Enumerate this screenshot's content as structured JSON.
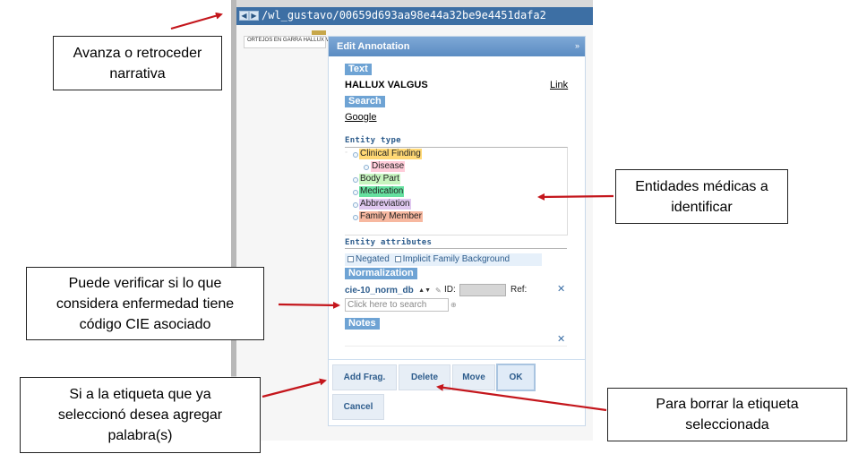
{
  "app": {
    "doc_path": "/wl_gustavo/00659d693aa98e44a32be9e4451dafa2",
    "nav_back_icon": "◀",
    "nav_forward_icon": "▶",
    "text_line": "ORTEJOS EN GARRA HALLUX VALGUS"
  },
  "dialog": {
    "title": "Edit Annotation",
    "close_icon": "»",
    "text_section": "Text",
    "text_value": "HALLUX VALGUS",
    "link_label": "Link",
    "search_section": "Search",
    "search_link": "Google",
    "entity_type_heading": "Entity type",
    "entity_types": [
      {
        "label": "Clinical Finding",
        "color": "#ffd875"
      },
      {
        "label": "Disease",
        "color": "#ffccd9"
      },
      {
        "label": "Body Part",
        "color": "#c8f5c0"
      },
      {
        "label": "Medication",
        "color": "#66e0a0"
      },
      {
        "label": "Abbreviation",
        "color": "#e0c8f0"
      },
      {
        "label": "Family Member",
        "color": "#f7b8a0"
      }
    ],
    "entity_attributes_heading": "Entity attributes",
    "attributes": [
      "Negated",
      "Implicit Family Background"
    ],
    "normalization_section": "Normalization",
    "norm_db": "cie-10_norm_db",
    "id_label": "ID:",
    "ref_label": "Ref:",
    "search_placeholder": "Click here to search",
    "notes_section": "Notes",
    "buttons": {
      "add_frag": "Add Frag.",
      "delete": "Delete",
      "move": "Move",
      "ok": "OK",
      "cancel": "Cancel"
    }
  },
  "callouts": {
    "narrative": "Avanza o retroceder\nnarrativa",
    "entities": "Entidades médicas a\nidentificar",
    "cie_check": "Puede verificar si lo que\nconsidera enfermedad tiene\ncódigo CIE asociado",
    "add_word": "Si a la etiqueta que ya\nseleccionó desea agregar\npalabra(s)",
    "delete_tag": "Para borrar la etiqueta\nseleccionada"
  },
  "colors": {
    "arrow": "#c4161c",
    "title_bar": "#3d6fa4",
    "dialog_header": "#5b8cc2"
  }
}
